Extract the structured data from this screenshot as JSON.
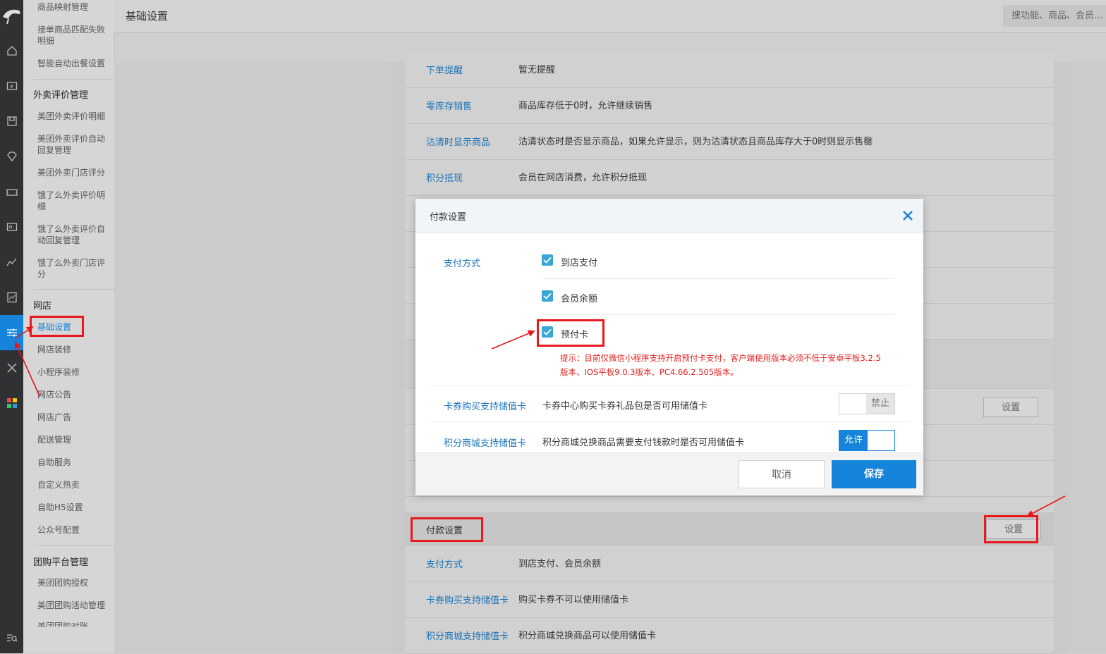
{
  "page": {
    "title": "基础设置",
    "search_placeholder": "搜功能、商品、会员..."
  },
  "rail": {
    "icons": [
      "logo-icon",
      "home-icon",
      "cashier-icon",
      "goods-icon",
      "member-icon",
      "coupon-icon",
      "card-icon",
      "report-icon",
      "stats-icon",
      "settings-icon",
      "tools-icon",
      "apps-icon",
      "search-menu-icon"
    ]
  },
  "submenu": {
    "top_items": [
      "商品映射管理",
      "接单商品匹配失败明细",
      "智能自动出餐设置"
    ],
    "group_review": "外卖评价管理",
    "review_items": [
      "美团外卖评价明细",
      "美团外卖评价自动回复管理",
      "美团外卖门店评分",
      "饿了么外卖评价明细",
      "饿了么外卖评价自动回复管理",
      "饿了么外卖门店评分"
    ],
    "group_shop": "网店",
    "shop_items": [
      "基础设置",
      "网店装修",
      "小程序装修",
      "网店公告",
      "网店广告",
      "配送管理",
      "自助服务",
      "自定义热卖",
      "自助H5设置",
      "公众号配置"
    ],
    "group_tuan": "团购平台管理",
    "tuan_items": [
      "美团团购授权",
      "美团团购活动管理",
      "美团团购对账"
    ]
  },
  "settings_rows": [
    {
      "label": "下单提醒",
      "value": "暂无提醒"
    },
    {
      "label": "零库存销售",
      "value": "商品库存低于0时，允许继续销售"
    },
    {
      "label": "沽清时显示商品",
      "value": "沽清状态时是否显示商品，如果允许显示，则为沽清状态且商品库存大于0时则显示售罄"
    },
    {
      "label": "积分抵现",
      "value": "会员在网店消费，允许积分抵现"
    }
  ],
  "set_button_label": "设置",
  "payment_section": {
    "title": "付款设置",
    "rows": [
      {
        "label": "支付方式",
        "value": "到店支付、会员余额"
      },
      {
        "label": "卡券购买支持储值卡",
        "value": "购买卡券不可以使用储值卡"
      },
      {
        "label": "积分商城支持储值卡",
        "value": "积分商城兑换商品可以使用储值卡"
      }
    ]
  },
  "modal": {
    "title": "付款设置",
    "pay_label": "支付方式",
    "options": [
      {
        "label": "到店支付",
        "checked": true
      },
      {
        "label": "会员余额",
        "checked": true
      },
      {
        "label": "预付卡",
        "checked": true
      }
    ],
    "hint_line1": "提示：目前仅微信小程序支持开启预付卡支付，客户端使用版本必须不低于安卓平板3.2.5",
    "hint_line2": "版本、IOS平板9.0.3版本、PC4.66.2.505版本。",
    "coupon_label": "卡券购买支持储值卡",
    "coupon_desc": "卡券中心购买卡券礼品包是否可用储值卡",
    "coupon_toggle": "禁止",
    "points_label": "积分商城支持储值卡",
    "points_desc": "积分商城兑换商品需要支付钱款时是否可用储值卡",
    "points_toggle": "允许",
    "cancel": "取消",
    "save": "保存"
  },
  "colors": {
    "accent": "#1584da",
    "annotation": "#e8181d",
    "hint": "#e02020"
  }
}
